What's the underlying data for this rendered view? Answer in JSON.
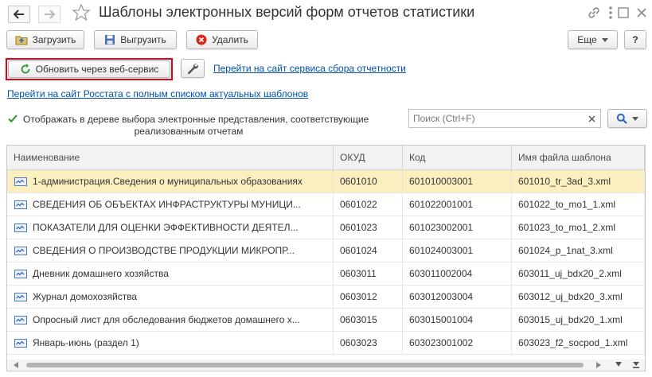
{
  "window": {
    "title": "Шаблоны электронных версий форм отчетов статистики"
  },
  "toolbar": {
    "load_label": "Загрузить",
    "unload_label": "Выгрузить",
    "delete_label": "Удалить",
    "more_label": "Еще",
    "help_label": "?"
  },
  "actions": {
    "update_label": "Обновить через веб-сервис",
    "service_link": "Перейти на сайт сервиса сбора отчетности",
    "rosstat_link": "Перейти на сайт Росстата с полным списком актуальных шаблонов"
  },
  "filter": {
    "checkbox_label_line1": "Отображать в дереве выбора электронные представления, соответствующие",
    "checkbox_label_line2": "реализованным отчетам",
    "checked": true,
    "search_placeholder": "Поиск (Ctrl+F)"
  },
  "table": {
    "columns": [
      "Наименование",
      "ОКУД",
      "Код",
      "Имя файла шаблона"
    ],
    "rows": [
      {
        "name": "1-администрация.Сведения о муниципальных образованиях",
        "okud": "0601010",
        "code": "601010003001",
        "file": "601010_tr_3ad_3.xml",
        "selected": true
      },
      {
        "name": "СВЕДЕНИЯ ОБ ОБЪЕКТАХ ИНФРАСТРУКТУРЫ МУНИЦИ...",
        "okud": "0601022",
        "code": "601022001001",
        "file": "601022_to_mo1_1.xml"
      },
      {
        "name": "ПОКАЗАТЕЛИ ДЛЯ ОЦЕНКИ ЭФФЕКТИВНОСТИ ДЕЯТЕЛ...",
        "okud": "0601023",
        "code": "601023002001",
        "file": "601023_to_mo1_2.xml"
      },
      {
        "name": "СВЕДЕНИЯ О ПРОИЗВОДСТВЕ ПРОДУКЦИИ МИКРОПР...",
        "okud": "0601024",
        "code": "601024003001",
        "file": "601024_p_1nat_3.xml"
      },
      {
        "name": "Дневник домашнего хозяйства",
        "okud": "0603011",
        "code": "603011002004",
        "file": "603011_uj_bdx20_2.xml"
      },
      {
        "name": "Журнал домохозяйства",
        "okud": "0603012",
        "code": "603012003004",
        "file": "603012_uj_bdx20_3.xml"
      },
      {
        "name": "Опросный лист для обследования бюджетов домашнего х...",
        "okud": "0603015",
        "code": "603015001004",
        "file": "603015_uj_bdx20_1.xml"
      },
      {
        "name": "Январь-июнь (раздел 1)",
        "okud": "0603023",
        "code": "603023001002",
        "file": "603023_f2_socpod_1.xml"
      }
    ]
  },
  "colors": {
    "accent_link": "#0050a8",
    "selected_row": "#fbeebf",
    "highlight_border": "#e0001a",
    "update_icon": "#3aa03a",
    "delete_icon": "#d9261c"
  },
  "icons": {
    "back": "arrow-left-icon",
    "forward": "arrow-right-icon",
    "favorite": "star-icon",
    "link": "link-icon",
    "menu": "kebab-icon",
    "maximize": "maximize-icon",
    "close": "close-icon",
    "load": "load-icon",
    "unload": "save-icon",
    "delete": "delete-icon",
    "update": "refresh-icon",
    "settings": "wrench-icon",
    "search": "magnifier-icon",
    "row": "form-template-icon"
  }
}
